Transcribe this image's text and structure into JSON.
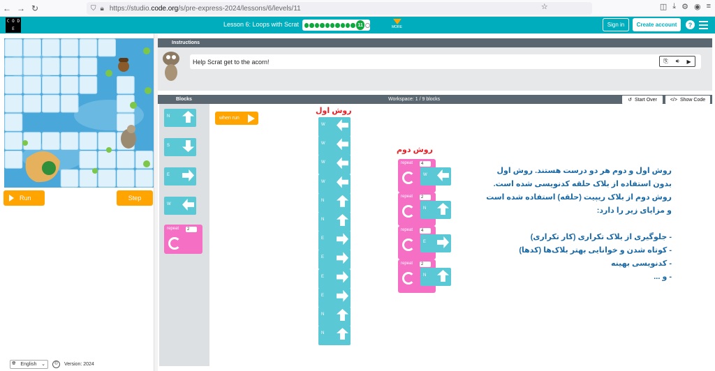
{
  "browser": {
    "url_prefix": "https://studio.",
    "url_host": "code.org",
    "url_path": "/s/pre-express-2024/lessons/6/levels/11"
  },
  "header": {
    "logo_letters": [
      "C",
      "O",
      "D",
      "",
      "E",
      ""
    ],
    "lesson_title": "Lesson 6: Loops with Scrat",
    "current_level": "11",
    "more_label": "MORE",
    "sign_in": "Sign in",
    "create_account": "Create account",
    "help": "?"
  },
  "game": {
    "run_label": "Run",
    "step_label": "Step"
  },
  "footer": {
    "language": "English",
    "copyright": "©",
    "version": "Version: 2024"
  },
  "instructions": {
    "header": "Instructions",
    "text": "Help Scrat get to the acorn!"
  },
  "workspace": {
    "blocks_header": "Blocks",
    "title": "Workspace: 1 / 9 blocks",
    "start_over": "Start Over",
    "show_code": "Show Code",
    "when_run": "when run",
    "method_one": "روش اول",
    "method_two": "روش دوم"
  },
  "toolbox": {
    "n": "N",
    "s": "S",
    "e": "E",
    "w": "W",
    "repeat_label": "repeat",
    "repeat_count": "2"
  },
  "blocks": {
    "w": "W",
    "n": "N",
    "e": "E",
    "repeat": "repeat",
    "repeat_counts": [
      "4",
      "2",
      "4",
      "2"
    ]
  },
  "explanation": {
    "line1": "روش اول و دوم هر دو درست هستند. روش اول",
    "line2": "بدون استفاده از بلاک حلقه کدنویسی شده است.",
    "line3": "روش دوم از بلاک ریپیت (حلقه) استفاده شده است",
    "line4": "و مزایای زیر را دارد:",
    "line5": "- جلوگیری از بلاک تکراری (کار تکراری)",
    "line6": "- کوتاه شدن و خوانایی بهتر بلاک‌ها (کدها)",
    "line7": "- کدنویسی بهینه",
    "line8": "- و ..."
  }
}
